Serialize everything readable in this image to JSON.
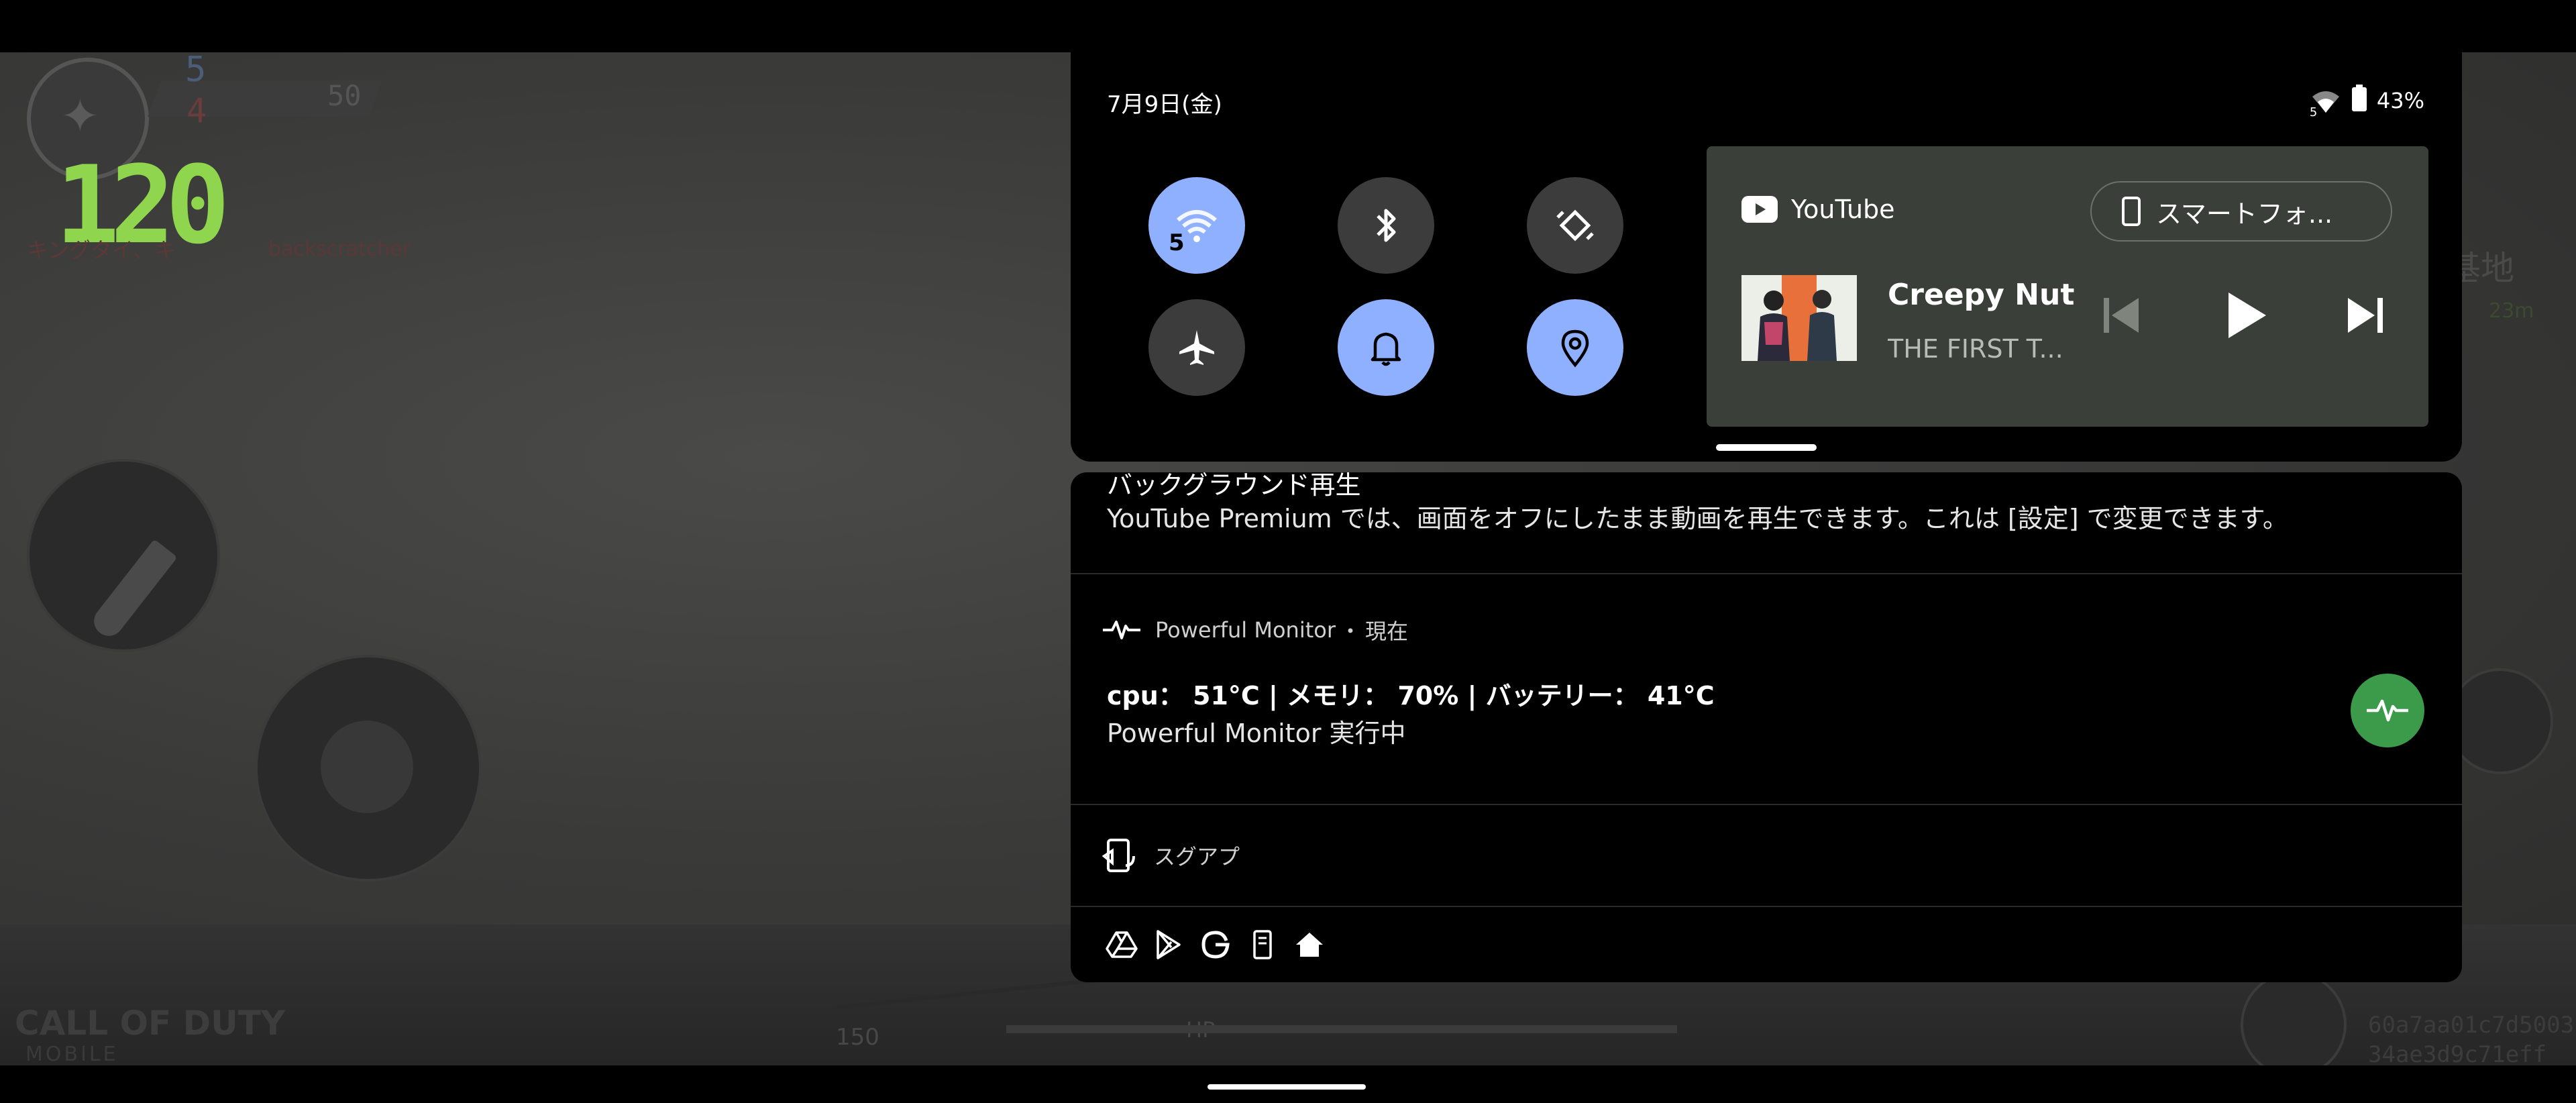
{
  "game": {
    "fps": "120",
    "team_score_blue": "5",
    "team_score_red": "4",
    "target_score": "50",
    "player_tag": "キングタイ、キ",
    "killfeed_name": "backscratcher",
    "health_label": "HP",
    "health_value": "150",
    "location_label": "基地",
    "distance": "23m",
    "brand_line1": "CALL OF DUTY",
    "brand_line2": "MOBILE",
    "session_code_1": "60a7aa01c7d5003",
    "session_code_2": "34ae3d9c71eff"
  },
  "status_bar": {
    "date": "7月9日(金)",
    "wifi_badge": "5",
    "battery": "43%"
  },
  "quick_settings": {
    "tiles": [
      {
        "name": "wifi",
        "on": true,
        "badge": "5"
      },
      {
        "name": "bluetooth",
        "on": false
      },
      {
        "name": "auto-rotate",
        "on": false
      },
      {
        "name": "airplane-mode",
        "on": false
      },
      {
        "name": "notification-sound",
        "on": true
      },
      {
        "name": "location",
        "on": true
      }
    ]
  },
  "media": {
    "app_name": "YouTube",
    "output_device": "スマートフォ...",
    "title": "Creepy Nut...",
    "artist": "THE FIRST T...",
    "colors": {
      "card": "#3b3f3a",
      "tile_on": "#8fb0ff"
    }
  },
  "notifications": {
    "youtube": {
      "title": "バックグラウンド再生",
      "body": "YouTube Premium では、画面をオフにしたまま動画を再生できます。これは [設定] で変更できます。"
    },
    "monitor": {
      "app": "Powerful Monitor",
      "time": "現在",
      "stats": "cpu： 51°C | メモリ： 70% | バッテリー： 41°C",
      "status": "Powerful Monitor 実行中"
    },
    "sugu": {
      "app": "スグアプ"
    },
    "overflow_icons": [
      "drive-icon",
      "play-store-icon",
      "google-icon",
      "phone-cast-icon",
      "home-icon"
    ]
  }
}
